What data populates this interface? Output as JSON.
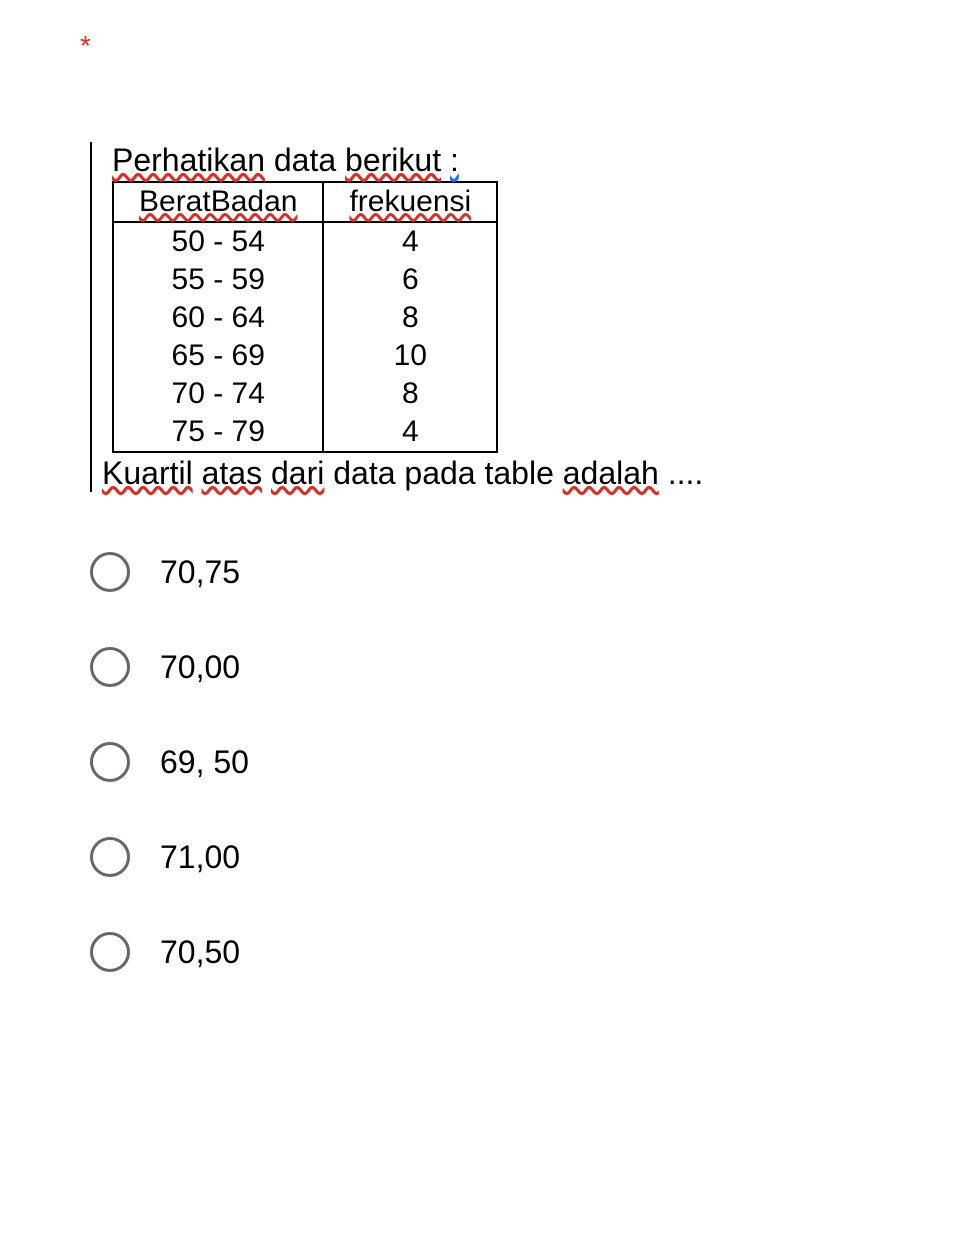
{
  "required_marker": "*",
  "question": {
    "title_parts": {
      "p1": "Perhatikan",
      "p2": "data",
      "p3": "berikut",
      "p4": ":"
    },
    "footer_parts": {
      "f1": "Kuartil",
      "f2": "atas",
      "f3": "dari",
      "f4": "data pada table",
      "f5": "adalah",
      "f6": "...."
    }
  },
  "chart_data": {
    "type": "table",
    "headers": {
      "col1": "BeratBadan",
      "col2": "frekuensi"
    },
    "rows": [
      {
        "range": "50 - 54",
        "freq": "4"
      },
      {
        "range": "55 - 59",
        "freq": "6"
      },
      {
        "range": "60 - 64",
        "freq": "8"
      },
      {
        "range": "65 - 69",
        "freq": "10"
      },
      {
        "range": "70 - 74",
        "freq": "8"
      },
      {
        "range": "75 - 79",
        "freq": "4"
      }
    ]
  },
  "options": [
    {
      "label": "70,75"
    },
    {
      "label": "70,00"
    },
    {
      "label": "69, 50"
    },
    {
      "label": "71,00"
    },
    {
      "label": "70,50"
    }
  ]
}
